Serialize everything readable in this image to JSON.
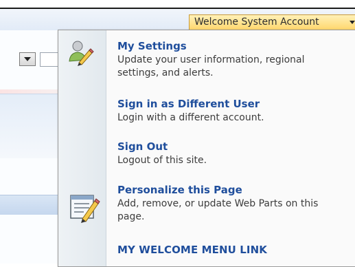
{
  "welcome_button": {
    "label": "Welcome System Account"
  },
  "menu": {
    "items": [
      {
        "title": "My Settings",
        "description": "Update your user information, regional settings, and alerts."
      },
      {
        "title": "Sign in as Different User",
        "description": "Login with a different account."
      },
      {
        "title": "Sign Out",
        "description": "Logout of this site."
      },
      {
        "title": "Personalize this Page",
        "description": "Add, remove, or update Web Parts on this page."
      },
      {
        "title": "MY WELCOME MENU LINK",
        "description": ""
      }
    ]
  },
  "icons": {
    "settings": "person-pencil-icon",
    "personalize": "edit-page-icon",
    "dropdown": "chevron-down-icon"
  },
  "colors": {
    "link": "#1f4e9c",
    "welcome_bg": "#ffd66a",
    "menu_gutter": "#e2e9ee"
  }
}
